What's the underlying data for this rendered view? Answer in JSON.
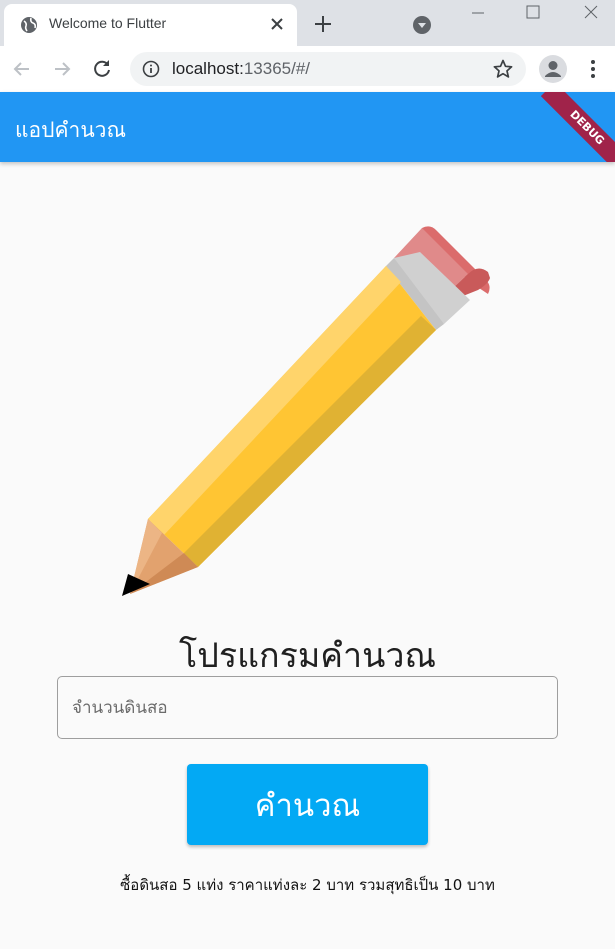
{
  "browser": {
    "tab_title": "Welcome to Flutter",
    "url_host": "localhost:",
    "url_rest": "13365/#/"
  },
  "app": {
    "title": "แอปคำนวณ",
    "debug_label": "DEBUG",
    "headline": "โปรแกรมคำนวณ",
    "input_placeholder": "จำนวนดินสอ",
    "button_label": "คำนวณ",
    "result_text": "ซื้อดินสอ 5 แท่ง ราคาแท่งละ 2 บาท รวมสุทธิเป็น 10 บาท"
  },
  "colors": {
    "appbar": "#2196f3",
    "button": "#03a9f4",
    "debug_banner": "#a0234a",
    "pencil_body": "#ffc533",
    "pencil_eraser": "#db6c6c"
  },
  "icons": {
    "favicon": "globe-icon",
    "tab_close": "close-icon",
    "new_tab": "plus-icon",
    "tab_search": "chevron-down-icon",
    "back": "arrow-left-icon",
    "forward": "arrow-right-icon",
    "reload": "reload-icon",
    "site_info": "info-icon",
    "bookmark": "star-icon",
    "profile": "profile-icon",
    "menu": "kebab-menu-icon",
    "illustration": "pencil-icon"
  }
}
